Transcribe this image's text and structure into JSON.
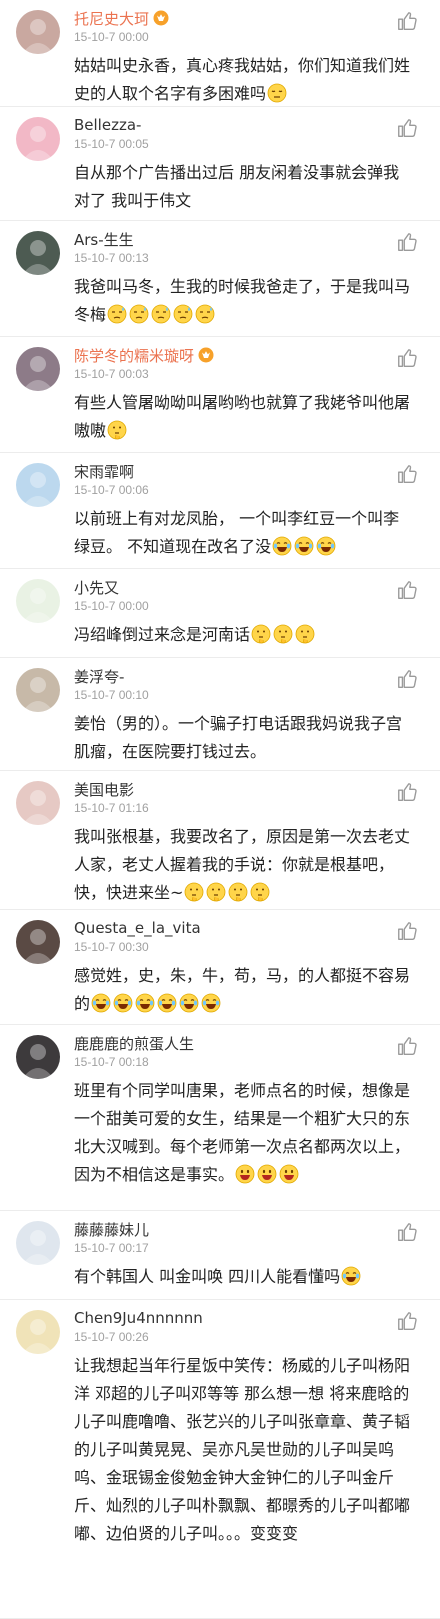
{
  "comments": [
    {
      "user": "托尼史大珂",
      "vip": true,
      "meta": "15-10-7 00:00",
      "text": "姑姑叫史永香，真心疼我姑姑，你们知道我们姓史的人取个名字有多困难吗",
      "emoji": [
        "sigh"
      ],
      "avatar_color": "#c9a8a0"
    },
    {
      "user": "Bellezza-",
      "vip": false,
      "meta": "15-10-7 00:05",
      "text": "自从那个广告播出过后 朋友闲着没事就会弹我 对了 我叫于伟文",
      "emoji": [],
      "avatar_color": "#f2b8c6"
    },
    {
      "user": "Ars-生生",
      "vip": false,
      "meta": "15-10-7 00:13",
      "text": "我爸叫马冬，生我的时候我爸走了，于是我叫马冬梅",
      "emoji": [
        "sweat",
        "sweat",
        "sweat",
        "sweat",
        "sweat"
      ],
      "avatar_color": "#4d5b52"
    },
    {
      "user": "陈学冬的糯米璇呀",
      "vip": true,
      "meta": "15-10-7 00:03",
      "text": "有些人管屠呦呦叫屠哟哟也就算了我姥爷叫他屠嗷嗷",
      "emoji": [
        "think"
      ],
      "avatar_color": "#8d7b88"
    },
    {
      "user": "宋雨霏啊",
      "vip": false,
      "meta": "15-10-7 00:06",
      "text": "以前班上有对龙凤胎， 一个叫李红豆一个叫李绿豆。 不知道现在改名了没",
      "emoji": [
        "laugh",
        "laugh",
        "laugh"
      ],
      "avatar_color": "#bcd8ee"
    },
    {
      "user": "小先又",
      "vip": false,
      "meta": "15-10-7 00:00",
      "text": "冯绍峰倒过来念是河南话",
      "emoji": [
        "think",
        "think",
        "think"
      ],
      "avatar_color": "#e9f2e4"
    },
    {
      "user": "姜浮夸-",
      "vip": false,
      "meta": "15-10-7 00:10",
      "text": "姜怡（男的）。一个骗子打电话跟我妈说我子宫肌瘤，在医院要打钱过去。",
      "emoji": [],
      "avatar_color": "#c7b9a8"
    },
    {
      "user": "美国电影",
      "vip": false,
      "meta": "15-10-7 01:16",
      "text": "我叫张根基，我要改名了，原因是第一次去老丈人家，老丈人握着我的手说：你就是根基吧，快，快进来坐~",
      "emoji": [
        "think",
        "think",
        "think",
        "think"
      ],
      "avatar_color": "#e6c9c4"
    },
    {
      "user": "Questa_e_la_vita",
      "vip": false,
      "meta": "15-10-7 00:30",
      "text": "感觉姓，史，朱，牛，苟，马，的人都挺不容易的",
      "emoji": [
        "laugh",
        "laugh",
        "laugh",
        "laugh",
        "laugh",
        "laugh"
      ],
      "avatar_color": "#5a4a44"
    },
    {
      "user": "鹿鹿鹿的煎蛋人生",
      "vip": false,
      "meta": "15-10-7 00:18",
      "text": "班里有个同学叫唐果，老师点名的时候，想像是一个甜美可爱的女生，结果是一个粗犷大只的东北大汉喊到。每个老师第一次点名都两次以上，因为不相信这是事实。",
      "emoji": [
        "grin",
        "grin",
        "grin"
      ],
      "avatar_color": "#3d3a3c"
    },
    {
      "user": "藤藤藤妹儿",
      "vip": false,
      "meta": "15-10-7 00:17",
      "text": "有个韩国人 叫金叫唤 四川人能看懂吗",
      "emoji": [
        "laugh"
      ],
      "avatar_color": "#dfe6ee"
    },
    {
      "user": "Chen9Ju4nnnnnn",
      "vip": false,
      "meta": "15-10-7 00:26",
      "text": "让我想起当年行星饭中笑传：杨威的儿子叫杨阳洋 邓超的儿子叫邓等等 那么想一想 将来鹿晗的儿子叫鹿噜噜、张艺兴的儿子叫张章章、黄子韬的儿子叫黄晃晃、吴亦凡吴世勋的儿子叫吴呜呜、金珉锡金俊勉金钟大金钟仁的儿子叫金斤斤、灿烈的儿子叫朴飘飘、都暻秀的儿子叫都嘟嘟、边伯贤的儿子叫。。。变变变",
      "emoji": [],
      "avatar_color": "#f0e3b8"
    }
  ]
}
